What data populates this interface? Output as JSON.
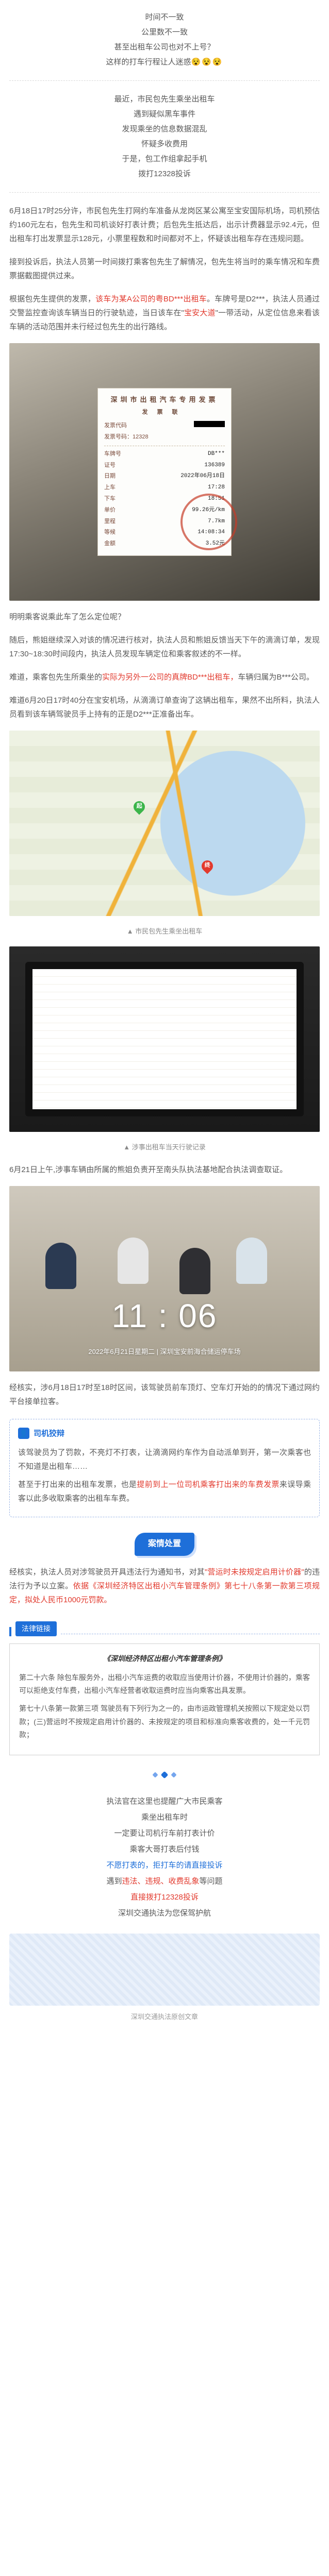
{
  "intro": {
    "l1": "时间不一致",
    "l2": "公里数不一致",
    "l3": "甚至出租车公司也对不上号？",
    "l4": "这样的打车行程让人迷惑",
    "emoji": "😵😵😵"
  },
  "complaint": {
    "l1": "最近，市民包先生乘坐出租车",
    "l2": "遇到疑似黑车事件",
    "l3": "发现乘坐的信息数据混乱",
    "l4": "怀疑多收费用",
    "l5": "于是，包工作组拿起手机",
    "l6": "拨打12328投诉"
  },
  "para1_a": "6月18日17时25分许，市民包先生打网约车准备从龙岗区某公寓至宝安国际机场，司机预估约160元左右，包先生和司机谈好打表计费；后包先生抵达后，出示计费器显示92.4元，但出租车打出发票显示128元，小票里程数和时间都对不上，怀疑该出租车存在违规问题。",
  "para2_a": "接到投诉后，执法人员第一时间拨打乘客包先生了解情况，包先生将当时的乘车情况和车费票据截图提供过来。",
  "para3_a": "根据包先生提供的发票，",
  "para3_b": "该车为某A公司的粤BD***出租车",
  "para3_c": "。车牌号是D2***，执法人员通过交警监控查询该车辆当日的行驶轨迹，当日该车在\"",
  "para3_d": "宝安大道",
  "para3_e": "\"一带活动，从定位信息来看该车辆的活动范围并未行经过包先生的出行路线。",
  "receipt": {
    "title": "深圳市出租汽车专用发票",
    "sub": "发票联",
    "code_lbl": "发票代码",
    "num_lbl": "发票号码：12328",
    "r_plate_lbl": "车牌号",
    "r_plate_val": "DB***",
    "r_cert_lbl": "证号",
    "r_cert_val": "136389",
    "r_date_lbl": "日期",
    "r_date_val": "2022年06月18日",
    "r_on_lbl": "上车",
    "r_on_val": "17:28",
    "r_off_lbl": "下车",
    "r_off_val": "18:51",
    "r_price_lbl": "单价",
    "r_price_val": "99.26元/km",
    "r_km_lbl": "里程",
    "r_km_val": "7.7km",
    "r_wait_lbl": "等候",
    "r_wait_val": "14:08:34",
    "r_amt_lbl": "金额",
    "r_amt_val": "3.52元"
  },
  "para4": "明明乘客说乘此车了怎么定位呢？",
  "para5_a": "随后，熊姐继续深入对该的情况进行核对，执法人员和熊姐反馈当天下午的滴滴订单，发现17:30~18:30时间段内，执法人员发现车辆定位和乘客叙述的不一样。",
  "para5_b": "难道，乘客包先生所乘坐的",
  "para5_c": "实际为另外一公司的真牌BD***出租车，",
  "para5_d": "车辆归属为B***公司。",
  "cap_map": "▲ 市民包先生乘坐出租车",
  "cap_laptop": "▲ 涉事出租车当天行驶记录",
  "para6": "难道6月20日17时40分在宝安机场，从滴滴订单查询了这辆出租车，果然不出所料，执法人员看到该车辆驾驶员手上持有的正是D2***正准备出车。",
  "para7": "6月21日上午,涉事车辆由所属的熊姐负责开至南头队执法基地配合执法调查取证。",
  "clock": "11 : 06",
  "clock_date": "2022年6月21日星期二 | 深圳宝安前海合储运停车场",
  "para8": "经核实，涉6月18日17时至18时区间，该驾驶员前车顶灯、空车灯开始的的情况下通过网约平台接单拉客。",
  "callout": {
    "label": "司机狡辩",
    "p1": "该驾驶员为了罚款，不亮灯不打表，让滴滴网约车作为自动派单到开，第一次乘客也不知道是出租车……",
    "p2_a": "甚至于打出来的出租车发票，也是",
    "p2_b": "提前到上一位司机乘客打出来的车费发票",
    "p2_c": "来误导乘客以此多收取乘客的出租车车费。"
  },
  "pill": "案情处置",
  "para9_a": "经核实，执法人员对涉驾驶员开具违法行为通知书，对其",
  "para9_b": "\"营运时未按规定启用计价器\"",
  "para9_c": "的违法行为予以立案。",
  "para9_d": "依据《深圳经济特区出租小汽车管理条例》第七十八条第一款第三项规定，拟处人民币1000元罚款。",
  "law_tag": "法律链接",
  "law_title": "《深圳经济特区出租小汽车管理条例》",
  "law_p1": "第二十六条  除包车服务外，出租小汽车运费的收取应当使用计价器，不使用计价器的，乘客可以拒绝支付车费，出租小汽车经营者收取运费时应当向乘客出具发票。",
  "law_p2": "第七十八条第一款第三项  驾驶员有下列行为之一的，由市运政管理机关按照以下规定处以罚款；(三)营运时不按规定启用计价器的、未按规定的项目和标准向乘客收费的，处一千元罚款；",
  "outro": {
    "l1": "执法官在这里也提醒广大市民乘客",
    "l2": "乘坐出租车时",
    "l3": "一定要让司机行车前打表计价",
    "l4": "乘客大哥打表后付钱",
    "l5_a": "不愿打表的，",
    "l5_b": "拒打车的请直接投诉",
    "l6": "遇到",
    "l6_b": "违法、违规、收费乱象",
    "l6_c": "等问题",
    "l7": "直接拨打12328投诉",
    "l8": "深圳交通执法为您保驾护航"
  },
  "foot_cap": "深圳交通执法原创文章"
}
